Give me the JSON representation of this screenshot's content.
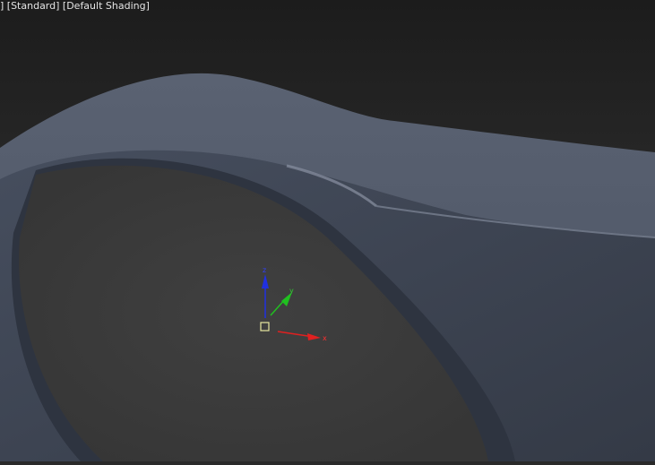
{
  "viewport": {
    "label": "] [Standard] [Default Shading]",
    "gizmo": {
      "x_label": "x",
      "y_label": "y",
      "z_label": "z"
    },
    "colors": {
      "background_top": "#1e1e1e",
      "background_bottom": "#3a3a3a",
      "object": "#4a5262",
      "x_axis": "#e02020",
      "y_axis": "#20c020",
      "z_axis": "#2030e0",
      "pivot": "#e8e8a0"
    }
  }
}
